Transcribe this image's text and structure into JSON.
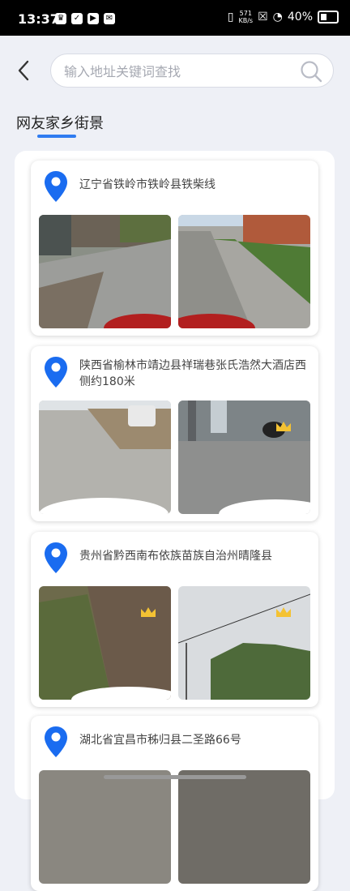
{
  "status": {
    "time": "13:37",
    "net_speed_top": "571",
    "net_speed_unit": "KB/s",
    "battery": "40%"
  },
  "search": {
    "placeholder": "输入地址关键词查找"
  },
  "section": {
    "title": "网友家乡街景"
  },
  "locations": [
    {
      "address": "辽宁省铁岭市铁岭县铁柴线"
    },
    {
      "address": "陕西省榆林市靖边县祥瑞巷张氏浩然大酒店西侧约180米"
    },
    {
      "address": "贵州省黔西南布依族苗族自治州晴隆县"
    },
    {
      "address": "湖北省宜昌市秭归县二圣路66号"
    }
  ],
  "colors": {
    "accent": "#2f7cf0",
    "pin": "#1a6cf0",
    "background": "#eef0f6"
  }
}
